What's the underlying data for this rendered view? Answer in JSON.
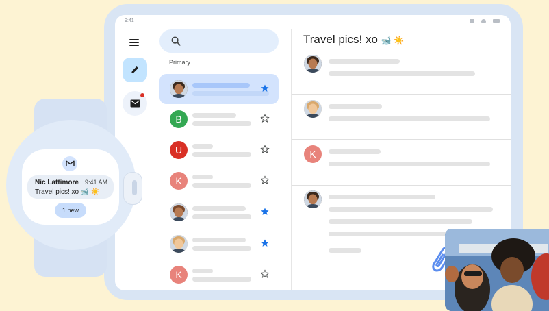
{
  "tablet": {
    "status_time": "9:41",
    "search_placeholder": "",
    "section_label": "Primary",
    "inbox": [
      {
        "avatar": "",
        "avatar_color": "#3c2a1e",
        "photo": true,
        "starred": true,
        "selected": true
      },
      {
        "avatar": "B",
        "avatar_color": "#34a853",
        "photo": false,
        "starred": false,
        "selected": false
      },
      {
        "avatar": "U",
        "avatar_color": "#d93025",
        "photo": false,
        "starred": false,
        "selected": false
      },
      {
        "avatar": "K",
        "avatar_color": "#e8837b",
        "photo": false,
        "starred": false,
        "selected": false
      },
      {
        "avatar": "",
        "avatar_color": "#7b4a2c",
        "photo": true,
        "starred": true,
        "selected": false
      },
      {
        "avatar": "",
        "avatar_color": "#d9a86c",
        "photo": true,
        "starred": true,
        "selected": false
      },
      {
        "avatar": "K",
        "avatar_color": "#e8837b",
        "photo": false,
        "starred": false,
        "selected": false
      }
    ],
    "thread": {
      "title": "Travel pics! xo",
      "title_emoji": "🐋 ☀️",
      "messages": [
        {
          "avatar": "",
          "avatar_color": "#3c2a1e",
          "photo": true
        },
        {
          "avatar": "",
          "avatar_color": "#d9a86c",
          "photo": true
        },
        {
          "avatar": "K",
          "avatar_color": "#e8837b",
          "photo": false
        },
        {
          "avatar": "",
          "avatar_color": "#3c2a1e",
          "photo": true
        }
      ]
    }
  },
  "watch": {
    "sender": "Nic Lattimore",
    "time": "9:41 AM",
    "preview": "Travel pics! xo 🐋 ☀️",
    "new_button": "1 new"
  },
  "colors": {
    "accent_blue": "#1a73e8",
    "star_outline": "#444746",
    "notification_dot": "#d93025"
  },
  "icons": [
    "menu-icon",
    "compose-pencil-icon",
    "mail-icon",
    "search-icon",
    "star-icon",
    "gmail-logo-icon",
    "paperclip-icon",
    "wifi-icon",
    "battery-icon",
    "signal-icon"
  ]
}
